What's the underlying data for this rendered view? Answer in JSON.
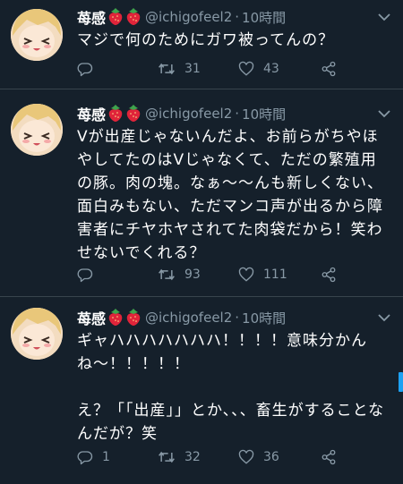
{
  "tweets": [
    {
      "name": "苺感",
      "handle": "@ichigofeel2",
      "time": "10時間",
      "text": "マジで何のためにガワ被ってんの？",
      "reply_count": "",
      "retweet_count": "31",
      "like_count": "43"
    },
    {
      "name": "苺感",
      "handle": "@ichigofeel2",
      "time": "10時間",
      "text": "Vが出産じゃないんだよ、お前らがちやほやしてたのはVじゃなくて、ただの繁殖用の豚。肉の塊。なぁ〜〜んも新しくない、面白みもない、ただマンコ声が出るから障害者にチヤホヤされてた肉袋だから！笑わせないでくれる？",
      "reply_count": "",
      "retweet_count": "93",
      "like_count": "111"
    },
    {
      "name": "苺感",
      "handle": "@ichigofeel2",
      "time": "10時間",
      "text": "ギャハハハハハハハ！！！！意味分かんね〜！！！！！\n\nえ？「「出産」」とか、、、畜生がすることなんだが？笑",
      "reply_count": "1",
      "retweet_count": "32",
      "like_count": "36"
    }
  ],
  "dot_separator": "·",
  "colors": {
    "background": "#15202b",
    "divider": "#38444d",
    "secondary_text": "#8899a6",
    "accent": "#1da1f2"
  },
  "icons": [
    "chevron-down-icon",
    "reply-icon",
    "retweet-icon",
    "like-icon",
    "share-icon",
    "strawberry-icon"
  ]
}
